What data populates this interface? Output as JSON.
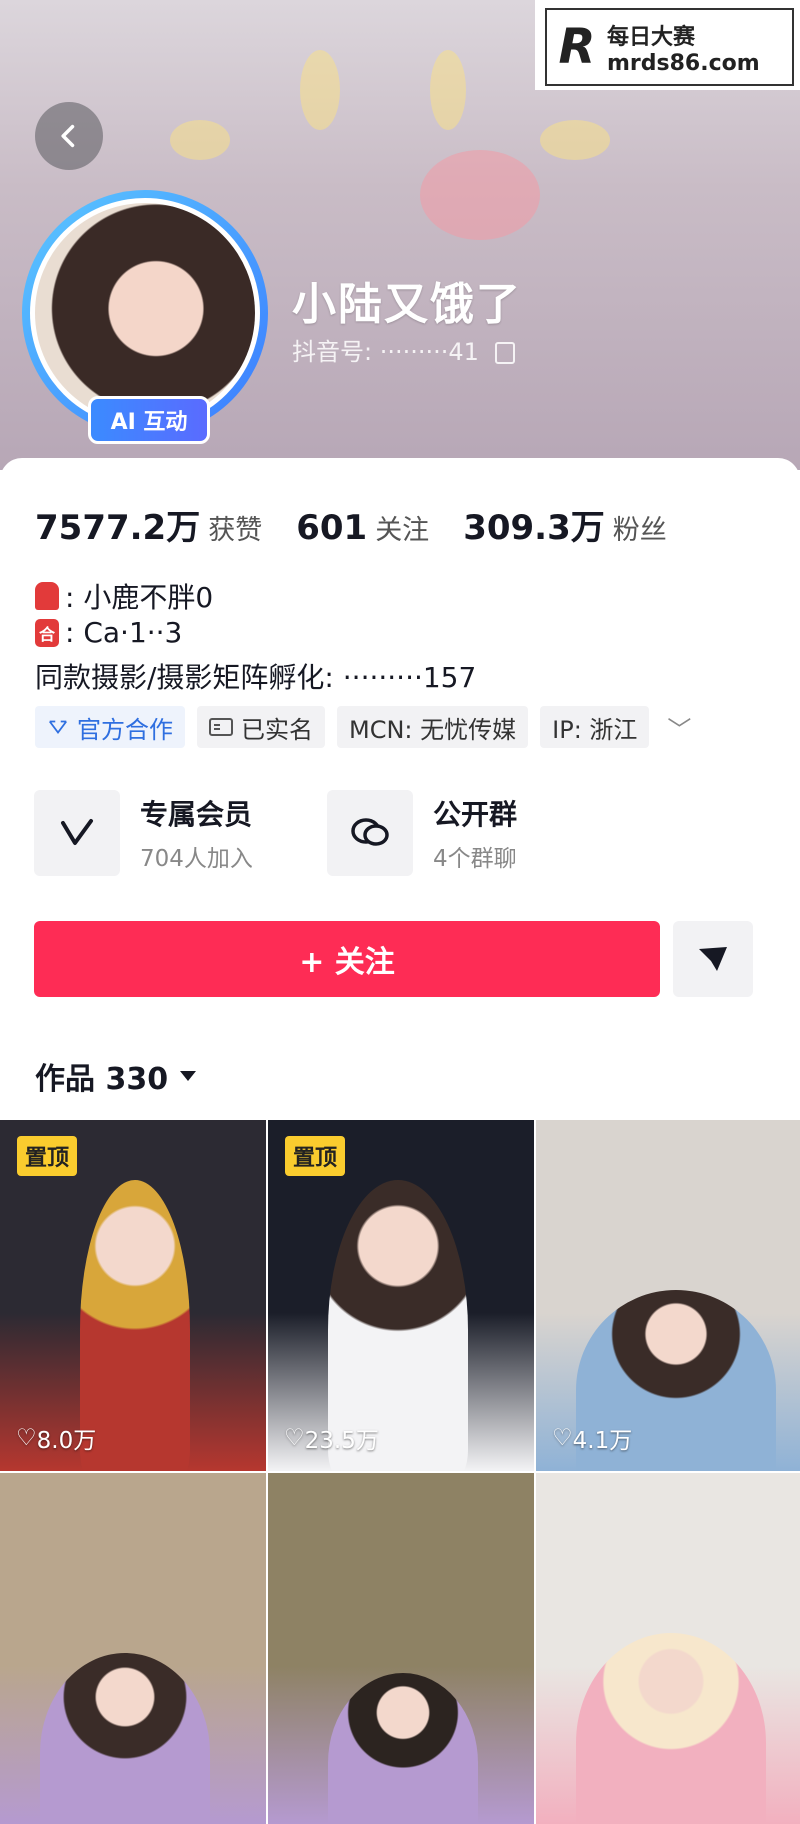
{
  "watermark": {
    "logo_letter": "R",
    "line1": "每日大赛",
    "line2": "mrds86.com"
  },
  "profile": {
    "nickname": "小陆又饿了",
    "douyin_id": "抖音号: ·········41",
    "avatar_badge": "AI 互动"
  },
  "stats": [
    {
      "value": "7577.2万",
      "label": "获赞"
    },
    {
      "value": "601",
      "label": "关注"
    },
    {
      "value": "309.3万",
      "label": "粉丝"
    }
  ],
  "bio": {
    "line1_text": ":  小鹿不胖0",
    "line2_icon": "合",
    "line2_text": ":  Ca·1··3",
    "line3_text": "同款摄影/摄影矩阵孵化:  ·········157"
  },
  "tags": [
    "官方合作",
    "已实名",
    "MCN: 无忧传媒",
    "IP: 浙江"
  ],
  "features": [
    {
      "title": "专属会员",
      "subtitle": "704人加入",
      "icon": "v-member-icon"
    },
    {
      "title": "公开群",
      "subtitle": "4个群聊",
      "icon": "chat-group-icon"
    }
  ],
  "actions": {
    "follow_label": "+ 关注"
  },
  "works": {
    "tab_label": "作品 330"
  },
  "videos": [
    {
      "pinned": "置顶",
      "likes": "8.0万",
      "colors": [
        "#2c2a33",
        "#b6372f",
        "#d8a63a"
      ]
    },
    {
      "pinned": "置顶",
      "likes": "23.5万",
      "colors": [
        "#1b1e29",
        "#f3f3f5",
        "#3a2c28"
      ]
    },
    {
      "pinned": "",
      "likes": "4.1万",
      "colors": [
        "#d9d4cf",
        "#8fb2d6",
        "#3a2c28"
      ]
    },
    {
      "pinned": "",
      "likes": "",
      "colors": [
        "#b9a68d",
        "#b59ad0",
        "#3a2c28"
      ]
    },
    {
      "pinned": "",
      "likes": "",
      "colors": [
        "#8e8264",
        "#b59ad0",
        "#2c2420"
      ]
    },
    {
      "pinned": "",
      "likes": "",
      "colors": [
        "#e9e6e2",
        "#f2b0bf",
        "#f7e7cc"
      ]
    }
  ],
  "theme": {
    "accent": "#fe2c55",
    "pin": "#facc2e",
    "tag_blue": "#2f6fe0"
  }
}
